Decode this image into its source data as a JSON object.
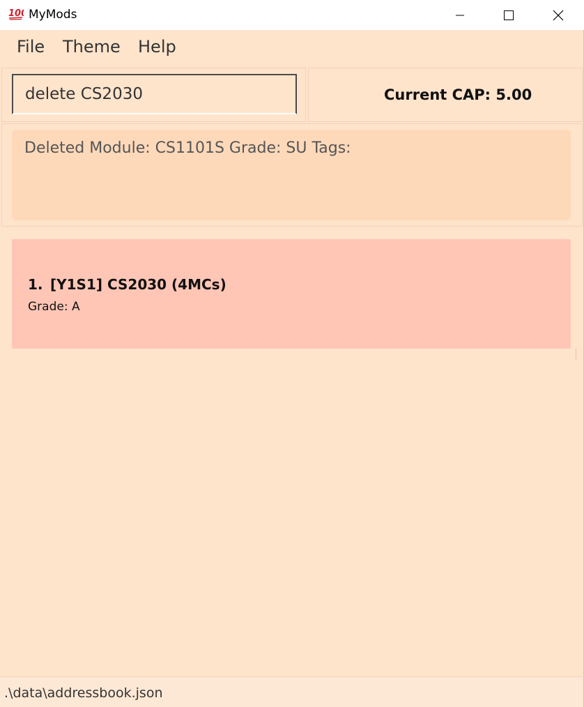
{
  "window": {
    "title": "MyMods",
    "icon": "hundred-points-emoji-icon",
    "controls": [
      "minimize-icon",
      "maximize-icon",
      "close-icon"
    ]
  },
  "menu": {
    "file": "File",
    "theme": "Theme",
    "help": "Help"
  },
  "command": {
    "value": "delete CS2030"
  },
  "cap": {
    "label": "Current CAP: 5.00"
  },
  "result": {
    "text": "Deleted Module: CS1101S Grade: SU Tags:"
  },
  "modules": [
    {
      "index": "1.",
      "title": "[Y1S1] CS2030 (4MCs)",
      "grade": "Grade: A"
    }
  ],
  "status": {
    "path": ".\\data\\addressbook.json"
  },
  "colors": {
    "background": "#ffe4cc",
    "result_box": "#fdd9ba",
    "module_card": "#ffc6b6",
    "status_bar": "#fde8d5"
  }
}
